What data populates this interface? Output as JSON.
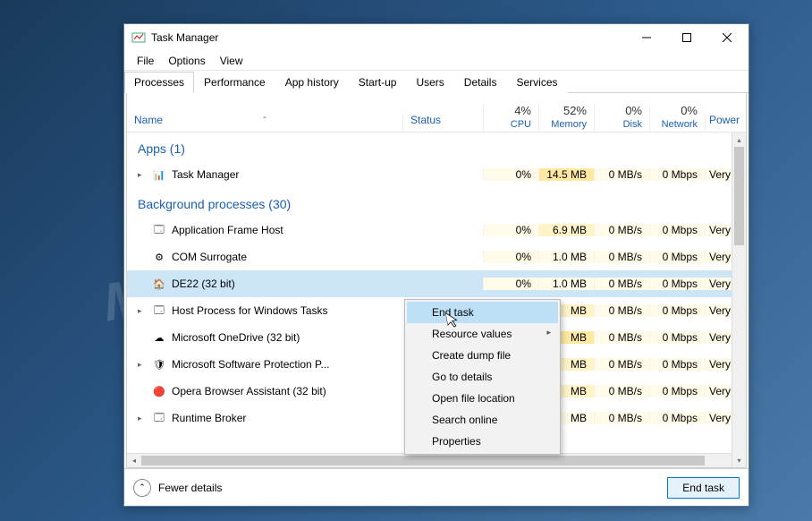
{
  "watermark": "MYANTISPYWARE.COM",
  "window": {
    "title": "Task Manager"
  },
  "menu": {
    "file": "File",
    "options": "Options",
    "view": "View"
  },
  "tabs": [
    "Processes",
    "Performance",
    "App history",
    "Start-up",
    "Users",
    "Details",
    "Services"
  ],
  "columns": {
    "name": "Name",
    "status": "Status",
    "cpu": {
      "pct": "4%",
      "label": "CPU"
    },
    "memory": {
      "pct": "52%",
      "label": "Memory"
    },
    "disk": {
      "pct": "0%",
      "label": "Disk"
    },
    "network": {
      "pct": "0%",
      "label": "Network"
    },
    "power": "Power"
  },
  "groups": {
    "apps": "Apps (1)",
    "background": "Background processes (30)"
  },
  "rows": [
    {
      "group": "apps",
      "expand": true,
      "icon": "task-manager-icon",
      "name": "Task Manager",
      "cpu": "0%",
      "memory": "14.5 MB",
      "disk": "0 MB/s",
      "network": "0 Mbps",
      "power": "Very",
      "heat": [
        0,
        2,
        0,
        0,
        0
      ],
      "selected": false
    },
    {
      "group": "bg",
      "expand": false,
      "icon": "app-frame-icon",
      "name": "Application Frame Host",
      "cpu": "0%",
      "memory": "6.9 MB",
      "disk": "0 MB/s",
      "network": "0 Mbps",
      "power": "Very",
      "heat": [
        0,
        1,
        0,
        0,
        0
      ],
      "selected": false
    },
    {
      "group": "bg",
      "expand": false,
      "icon": "com-icon",
      "name": "COM Surrogate",
      "cpu": "0%",
      "memory": "1.0 MB",
      "disk": "0 MB/s",
      "network": "0 Mbps",
      "power": "Very",
      "heat": [
        0,
        0,
        0,
        0,
        0
      ],
      "selected": false
    },
    {
      "group": "bg",
      "expand": false,
      "icon": "de22-icon",
      "name": "DE22 (32 bit)",
      "cpu": "0%",
      "memory": "1.0 MB",
      "disk": "0 MB/s",
      "network": "0 Mbps",
      "power": "Very",
      "heat": [
        0,
        0,
        0,
        0,
        0
      ],
      "selected": true
    },
    {
      "group": "bg",
      "expand": true,
      "icon": "host-process-icon",
      "name": "Host Process for Windows Tasks",
      "cpu": "",
      "memory": "MB",
      "disk": "0 MB/s",
      "network": "0 Mbps",
      "power": "Very",
      "heat": [
        0,
        1,
        0,
        0,
        0
      ],
      "selected": false
    },
    {
      "group": "bg",
      "expand": false,
      "icon": "onedrive-icon",
      "name": "Microsoft OneDrive (32 bit)",
      "cpu": "",
      "memory": "MB",
      "disk": "0 MB/s",
      "network": "0 Mbps",
      "power": "Very",
      "heat": [
        0,
        2,
        0,
        0,
        0
      ],
      "selected": false
    },
    {
      "group": "bg",
      "expand": true,
      "icon": "ms-protection-icon",
      "name": "Microsoft Software Protection P...",
      "cpu": "",
      "memory": "MB",
      "disk": "0 MB/s",
      "network": "0 Mbps",
      "power": "Very",
      "heat": [
        0,
        1,
        0,
        0,
        0
      ],
      "selected": false
    },
    {
      "group": "bg",
      "expand": false,
      "icon": "opera-icon",
      "name": "Opera Browser Assistant (32 bit)",
      "cpu": "",
      "memory": "MB",
      "disk": "0 MB/s",
      "network": "0 Mbps",
      "power": "Very",
      "heat": [
        0,
        1,
        0,
        0,
        0
      ],
      "selected": false
    },
    {
      "group": "bg",
      "expand": true,
      "icon": "runtime-broker-icon",
      "name": "Runtime Broker",
      "cpu": "",
      "memory": "MB",
      "disk": "0 MB/s",
      "network": "0 Mbps",
      "power": "Very",
      "heat": [
        0,
        0,
        0,
        0,
        0
      ],
      "selected": false
    }
  ],
  "context_menu": {
    "items": [
      {
        "label": "End task",
        "highlight": true
      },
      {
        "label": "Resource values",
        "submenu": true
      },
      {
        "label": "Create dump file"
      },
      {
        "label": "Go to details"
      },
      {
        "label": "Open file location"
      },
      {
        "label": "Search online"
      },
      {
        "label": "Properties"
      }
    ]
  },
  "footer": {
    "fewer_details": "Fewer details",
    "end_task": "End task"
  },
  "icons": {
    "task-manager-icon": "📊",
    "app-frame-icon": "🗔",
    "com-icon": "⚙",
    "de22-icon": "🏠",
    "host-process-icon": "🗔",
    "onedrive-icon": "☁",
    "ms-protection-icon": "🛡",
    "opera-icon": "🔴",
    "runtime-broker-icon": "🗔"
  }
}
